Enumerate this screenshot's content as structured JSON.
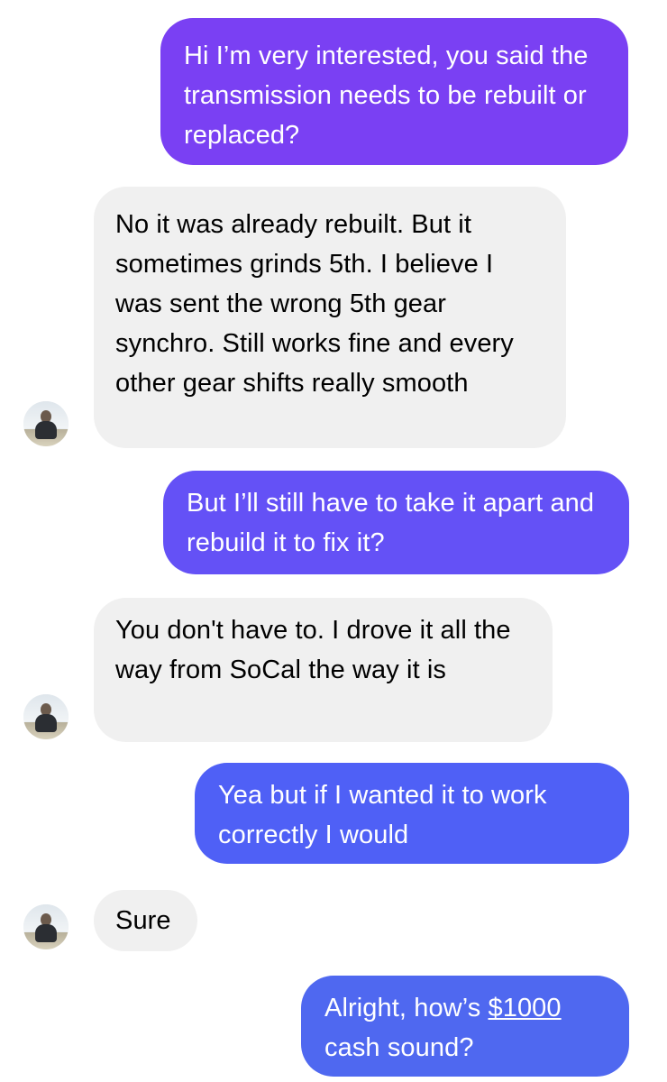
{
  "colors": {
    "sent_1": "#7b3ff3",
    "sent_2": "#6550f6",
    "sent_3": "#4f5ef6",
    "sent_4": "#4f68f0",
    "received_bg": "#f0f0f0"
  },
  "messages": [
    {
      "direction": "sent",
      "text": "Hi I’m very interested, you said the transmission needs to be rebuilt or replaced?"
    },
    {
      "direction": "received",
      "text": "No it was already rebuilt. But it sometimes grinds 5th. I believe I was sent the wrong 5th gear synchro. Still works fine and every other gear shifts really smooth",
      "avatar": "contact-avatar"
    },
    {
      "direction": "sent",
      "text": "But I’ll still have to take it apart and rebuild it to fix it?"
    },
    {
      "direction": "received",
      "text": "You don't have to. I drove it all the way from SoCal the way it is",
      "avatar": "contact-avatar"
    },
    {
      "direction": "sent",
      "text": "Yea but if I wanted it to work correctly I would"
    },
    {
      "direction": "received",
      "text": "Sure",
      "avatar": "contact-avatar"
    },
    {
      "direction": "sent",
      "text_before": "Alright, how’s ",
      "link": "$1000",
      "text_after": " cash sound?"
    }
  ]
}
